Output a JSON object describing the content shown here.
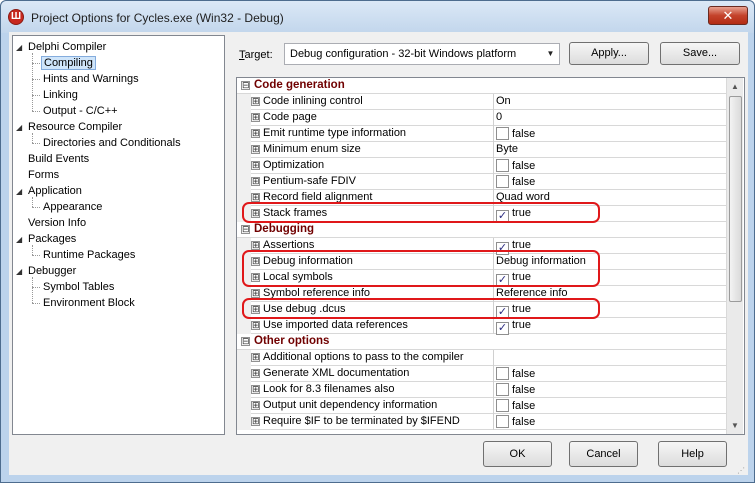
{
  "window": {
    "title": "Project Options for Cycles.exe  (Win32 - Debug)",
    "close_glyph": "✕",
    "app_icon_glyph": "Ш"
  },
  "tree": {
    "items": [
      {
        "label": "Delphi Compiler",
        "expander": "◢"
      },
      {
        "label": "Compiling"
      },
      {
        "label": "Hints and Warnings"
      },
      {
        "label": "Linking"
      },
      {
        "label": "Output - C/C++"
      },
      {
        "label": "Resource Compiler",
        "expander": "◢"
      },
      {
        "label": "Directories and Conditionals"
      },
      {
        "label": "Build Events"
      },
      {
        "label": "Forms"
      },
      {
        "label": "Application",
        "expander": "◢"
      },
      {
        "label": "Appearance"
      },
      {
        "label": "Version Info"
      },
      {
        "label": "Packages",
        "expander": "◢"
      },
      {
        "label": "Runtime Packages"
      },
      {
        "label": "Debugger",
        "expander": "◢"
      },
      {
        "label": "Symbol Tables"
      },
      {
        "label": "Environment Block"
      }
    ],
    "selected": "Compiling"
  },
  "target": {
    "label_prefix": "",
    "label_underlined": "T",
    "label_rest": "arget:",
    "value": "Debug configuration - 32-bit Windows platform",
    "apply_label": "Apply...",
    "save_label": "Save..."
  },
  "grid": {
    "rows": [
      {
        "type": "cat",
        "name": "Code generation",
        "sign": "⊟"
      },
      {
        "type": "row",
        "name": "Code inlining control",
        "value": "On"
      },
      {
        "type": "row",
        "name": "Code page",
        "value": "0"
      },
      {
        "type": "row",
        "name": "Emit runtime type information",
        "value": "false",
        "check": false
      },
      {
        "type": "row",
        "name": "Minimum enum size",
        "value": "Byte"
      },
      {
        "type": "row",
        "name": "Optimization",
        "value": "false",
        "check": false
      },
      {
        "type": "row",
        "name": "Pentium-safe FDIV",
        "value": "false",
        "check": false
      },
      {
        "type": "row",
        "name": "Record field alignment",
        "value": "Quad word"
      },
      {
        "type": "row",
        "name": "Stack frames",
        "value": "true",
        "check": true
      },
      {
        "type": "cat",
        "name": "Debugging",
        "sign": "⊟"
      },
      {
        "type": "row",
        "name": "Assertions",
        "value": "true",
        "check": true
      },
      {
        "type": "row",
        "name": "Debug information",
        "value": "Debug information"
      },
      {
        "type": "row",
        "name": "Local symbols",
        "value": "true",
        "check": true
      },
      {
        "type": "row",
        "name": "Symbol reference info",
        "value": "Reference info"
      },
      {
        "type": "row",
        "name": "Use debug .dcus",
        "value": "true",
        "check": true
      },
      {
        "type": "row",
        "name": "Use imported data references",
        "value": "true",
        "check": true
      },
      {
        "type": "cat",
        "name": "Other options",
        "sign": "⊟"
      },
      {
        "type": "row",
        "name": "Additional options to pass to the compiler",
        "value": ""
      },
      {
        "type": "row",
        "name": "Generate XML documentation",
        "value": "false",
        "check": false
      },
      {
        "type": "row",
        "name": "Look for 8.3 filenames also",
        "value": "false",
        "check": false
      },
      {
        "type": "row",
        "name": "Output unit dependency information",
        "value": "false",
        "check": false
      },
      {
        "type": "row",
        "name": "Require $IF to be terminated by $IFEND",
        "value": "false",
        "check": false
      }
    ],
    "expand_sign": "⊞",
    "check_glyph": "✓",
    "scroll_up_glyph": "▲",
    "scroll_down_glyph": "▼"
  },
  "footer": {
    "ok_label": "OK",
    "cancel_label": "Cancel",
    "help_label": "Help"
  },
  "colors": {
    "category_text": "#700000",
    "highlight": "#e0181a",
    "selection": "#cfe5fa"
  }
}
